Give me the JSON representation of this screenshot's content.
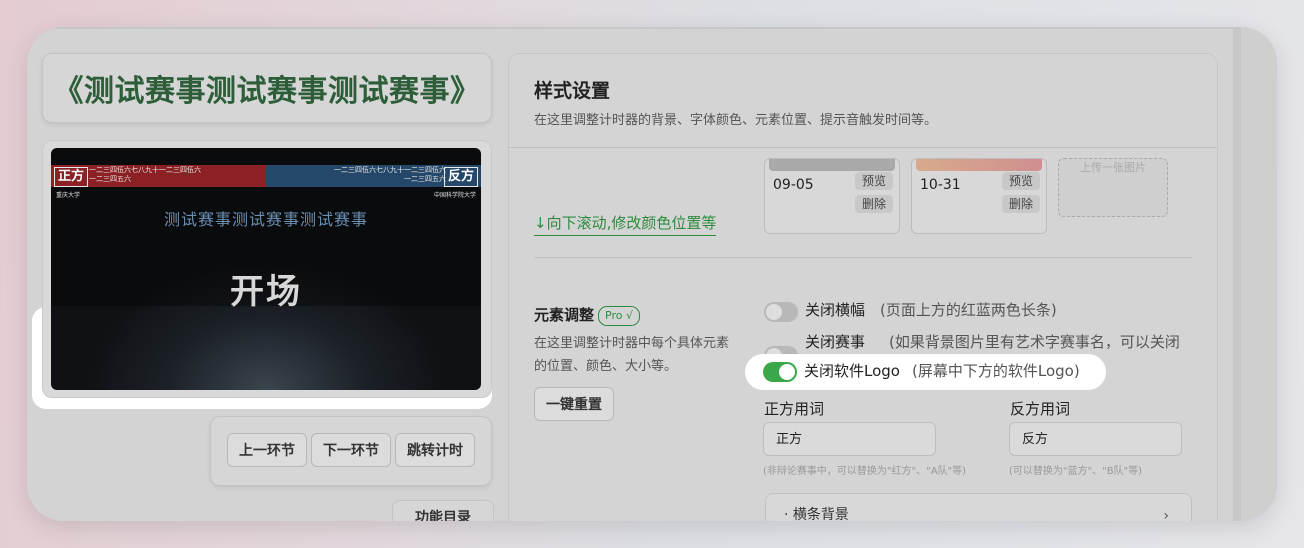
{
  "event_title": "《测试赛事测试赛事测试赛事》",
  "preview": {
    "left_side": "正方",
    "right_side": "反方",
    "left_names": [
      "一二三四伍六七八九十一二三四伍六",
      "一二三四五六"
    ],
    "right_names": [
      "一二三四伍六七八九十一二三四伍六",
      "一二三四五六"
    ],
    "left_school": "重庆大学",
    "right_school": "中国科学院大学",
    "event_name": "测试赛事测试赛事测试赛事",
    "stage": "开场"
  },
  "controls": {
    "prev": "上一环节",
    "next": "下一环节",
    "jump": "跳转计时",
    "menu": "功能目录"
  },
  "panel": {
    "title": "样式设置",
    "subtitle": "在这里调整计时器的背景、字体颜色、元素位置、提示音触发时间等。",
    "scroll_hint": "↓向下滚动,修改颜色位置等",
    "backgrounds": [
      {
        "date": "09-05",
        "preview": "预览",
        "delete": "删除"
      },
      {
        "date": "10-31",
        "preview": "预览",
        "delete": "删除"
      }
    ],
    "upload": "上传一张图片",
    "element_section": {
      "title": "元素调整",
      "pro": "Pro √",
      "description": "在这里调整计时器中每个具体元素的位置、颜色、大小等。",
      "reset": "一键重置"
    },
    "options": [
      {
        "label": "关闭横幅",
        "desc": "(页面上方的红蓝两色长条)",
        "on": false
      },
      {
        "label": "关闭赛事名称",
        "desc": "(如果背景图片里有艺术字赛事名，可以关闭赛事名称显示)",
        "on": false
      },
      {
        "label": "关闭软件Logo",
        "desc": "(屏幕中下方的软件Logo)",
        "on": true
      }
    ],
    "pro_word": {
      "label": "正方用词",
      "value": "正方",
      "hint": "(非辩论赛事中，可以替换为\"红方\"、\"A队\"等)"
    },
    "con_word": {
      "label": "反方用词",
      "value": "反方",
      "hint": "(可以替换为\"蓝方\"、\"B队\"等)"
    },
    "accordion": "· 横条背景"
  },
  "colors": {
    "accent_green": "#3aa84a",
    "title_green": "#2d5e39",
    "banner_red": "#8b2124",
    "banner_blue": "#25486a"
  }
}
